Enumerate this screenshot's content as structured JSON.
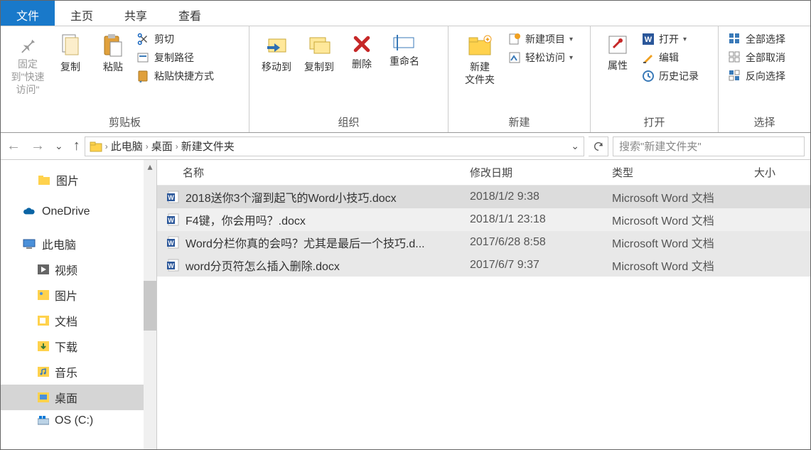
{
  "tabs": {
    "file": "文件",
    "home": "主页",
    "share": "共享",
    "view": "查看"
  },
  "ribbon": {
    "clipboard": {
      "pin": "固定到\"快速访问\"",
      "copy": "复制",
      "paste": "粘贴",
      "cut": "剪切",
      "copypath": "复制路径",
      "pasteshortcut": "粘贴快捷方式",
      "label": "剪贴板"
    },
    "organize": {
      "moveto": "移动到",
      "copyto": "复制到",
      "delete": "删除",
      "rename": "重命名",
      "label": "组织"
    },
    "new": {
      "newfolder": "新建\n文件夹",
      "newitem": "新建项目",
      "easyaccess": "轻松访问",
      "label": "新建"
    },
    "open": {
      "properties": "属性",
      "open": "打开",
      "edit": "编辑",
      "history": "历史记录",
      "label": "打开"
    },
    "select": {
      "selectall": "全部选择",
      "selectnone": "全部取消",
      "invertsel": "反向选择",
      "label": "选择"
    }
  },
  "breadcrumb": {
    "pc": "此电脑",
    "desktop": "桌面",
    "folder": "新建文件夹"
  },
  "search": {
    "placeholder": "搜索\"新建文件夹\""
  },
  "sidebar": {
    "pictures": "图片",
    "onedrive": "OneDrive",
    "thispc": "此电脑",
    "videos": "视频",
    "pictures2": "图片",
    "documents": "文档",
    "downloads": "下载",
    "music": "音乐",
    "desktop": "桌面",
    "osc": "OS (C:)"
  },
  "columns": {
    "name": "名称",
    "date": "修改日期",
    "type": "类型",
    "size": "大小"
  },
  "files": [
    {
      "name": "2018送你3个溜到起飞的Word小技巧.docx",
      "date": "2018/1/2 9:38",
      "type": "Microsoft Word 文档"
    },
    {
      "name": "F4键，你会用吗？.docx",
      "date": "2018/1/1 23:18",
      "type": "Microsoft Word 文档"
    },
    {
      "name": "Word分栏你真的会吗？尤其是最后一个技巧.d...",
      "date": "2017/6/28 8:58",
      "type": "Microsoft Word 文档"
    },
    {
      "name": "word分页符怎么插入删除.docx",
      "date": "2017/6/7 9:37",
      "type": "Microsoft Word 文档"
    }
  ]
}
